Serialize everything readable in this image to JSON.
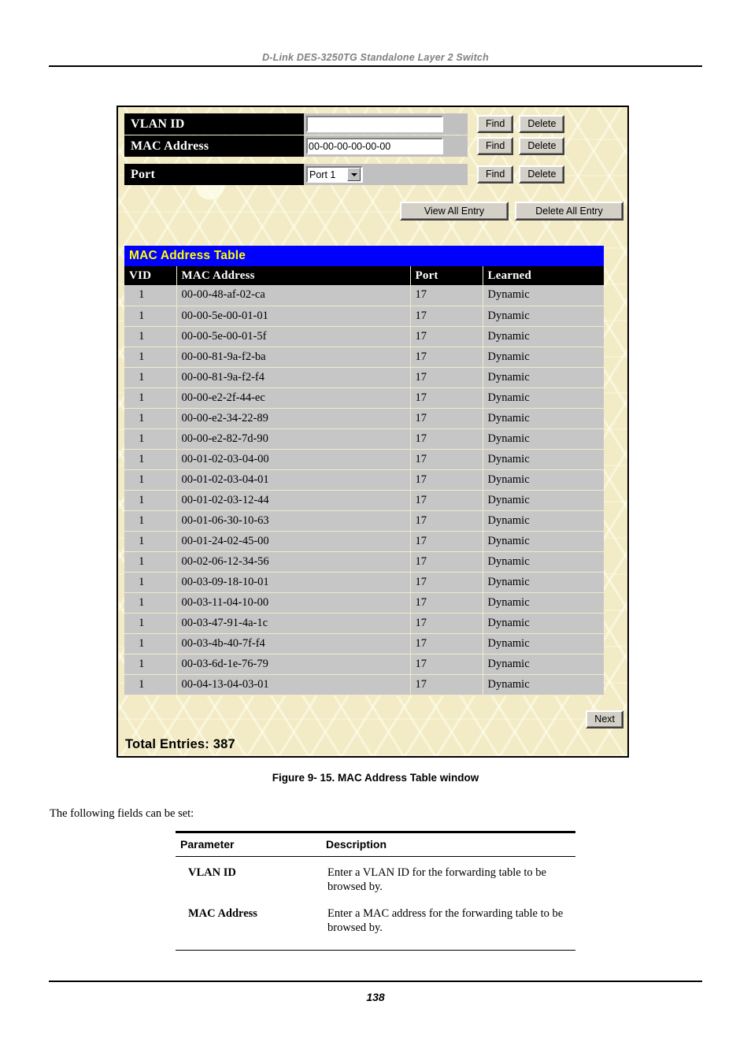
{
  "document": {
    "running_header": "D-Link DES-3250TG Standalone Layer 2 Switch",
    "figure_caption": "Figure 9- 15.  MAC Address Table window",
    "fields_intro": "The following fields can be set:",
    "page_number": "138"
  },
  "window": {
    "query_rows": [
      {
        "label": "VLAN ID",
        "control": "text",
        "value": "",
        "placeholder": "",
        "find_label": "Find",
        "delete_label": "Delete"
      },
      {
        "label": "MAC Address",
        "control": "text",
        "value": "00-00-00-00-00-00",
        "placeholder": "00-00-00-00-00-00",
        "find_label": "Find",
        "delete_label": "Delete"
      },
      {
        "label": "Port",
        "control": "select",
        "value": "Port 1",
        "options": [
          "Port 1"
        ],
        "find_label": "Find",
        "delete_label": "Delete"
      }
    ],
    "view_all_label": "View All Entry",
    "delete_all_label": "Delete All Entry",
    "table": {
      "title": "MAC Address Table",
      "columns": [
        "VID",
        "MAC Address",
        "Port",
        "Learned"
      ],
      "rows": [
        [
          "1",
          "00-00-48-af-02-ca",
          "17",
          "Dynamic"
        ],
        [
          "1",
          "00-00-5e-00-01-01",
          "17",
          "Dynamic"
        ],
        [
          "1",
          "00-00-5e-00-01-5f",
          "17",
          "Dynamic"
        ],
        [
          "1",
          "00-00-81-9a-f2-ba",
          "17",
          "Dynamic"
        ],
        [
          "1",
          "00-00-81-9a-f2-f4",
          "17",
          "Dynamic"
        ],
        [
          "1",
          "00-00-e2-2f-44-ec",
          "17",
          "Dynamic"
        ],
        [
          "1",
          "00-00-e2-34-22-89",
          "17",
          "Dynamic"
        ],
        [
          "1",
          "00-00-e2-82-7d-90",
          "17",
          "Dynamic"
        ],
        [
          "1",
          "00-01-02-03-04-00",
          "17",
          "Dynamic"
        ],
        [
          "1",
          "00-01-02-03-04-01",
          "17",
          "Dynamic"
        ],
        [
          "1",
          "00-01-02-03-12-44",
          "17",
          "Dynamic"
        ],
        [
          "1",
          "00-01-06-30-10-63",
          "17",
          "Dynamic"
        ],
        [
          "1",
          "00-01-24-02-45-00",
          "17",
          "Dynamic"
        ],
        [
          "1",
          "00-02-06-12-34-56",
          "17",
          "Dynamic"
        ],
        [
          "1",
          "00-03-09-18-10-01",
          "17",
          "Dynamic"
        ],
        [
          "1",
          "00-03-11-04-10-00",
          "17",
          "Dynamic"
        ],
        [
          "1",
          "00-03-47-91-4a-1c",
          "17",
          "Dynamic"
        ],
        [
          "1",
          "00-03-4b-40-7f-f4",
          "17",
          "Dynamic"
        ],
        [
          "1",
          "00-03-6d-1e-76-79",
          "17",
          "Dynamic"
        ],
        [
          "1",
          "00-04-13-04-03-01",
          "17",
          "Dynamic"
        ]
      ]
    },
    "next_label": "Next",
    "total_entries": "Total Entries: 387"
  },
  "param_table": {
    "headers": [
      "Parameter",
      "Description"
    ],
    "rows": [
      {
        "name": "VLAN ID",
        "description": "Enter a VLAN ID for the forwarding table to be browsed by."
      },
      {
        "name": "MAC Address",
        "description": "Enter a MAC address for the forwarding table to be browsed by."
      }
    ]
  },
  "colors": {
    "title_bar_bg": "#0000ff",
    "title_bar_fg": "#ffff00",
    "window_bg": "#f2ebc5",
    "row_bg": "#c6c6c6",
    "header_bg": "#000000",
    "header_fg": "#ffffff",
    "button_face": "#d4d0c8"
  }
}
